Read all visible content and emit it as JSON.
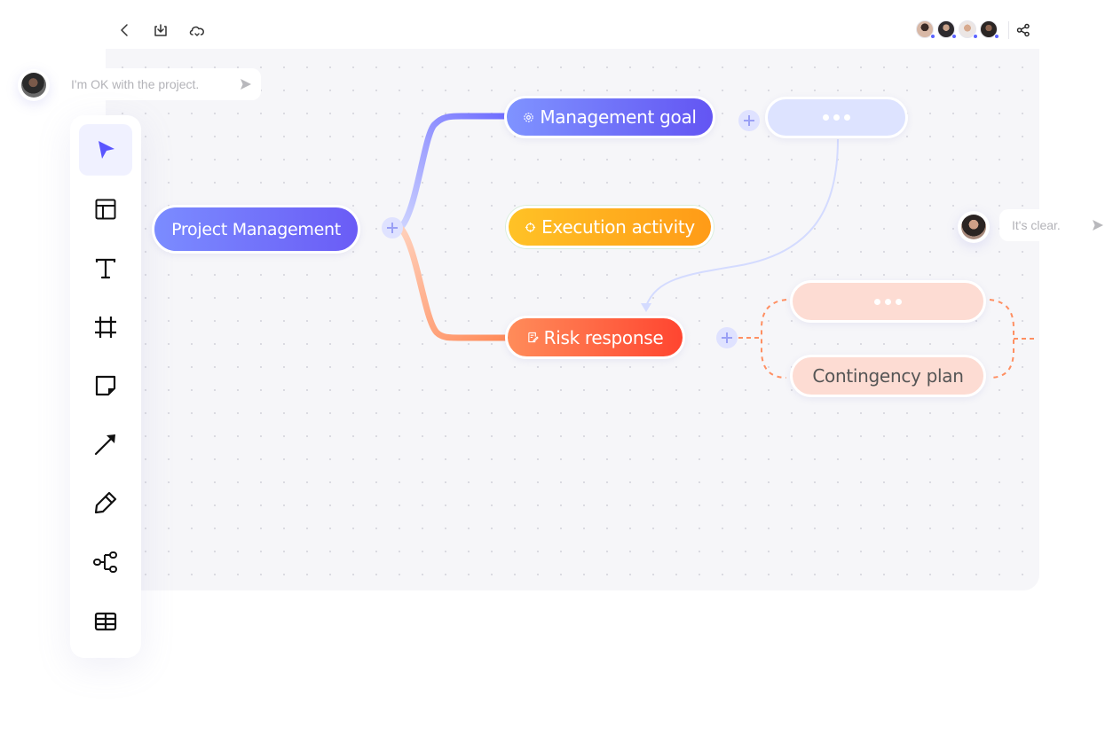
{
  "topbar": {
    "back_icon": "chevron-left-icon",
    "download_icon": "download-icon",
    "cloud_icon": "cloud-sync-icon",
    "collaborators": [
      {
        "name": "collaborator-1",
        "status": "online"
      },
      {
        "name": "collaborator-2",
        "status": "online"
      },
      {
        "name": "collaborator-3",
        "status": "online"
      },
      {
        "name": "collaborator-4",
        "status": "online"
      }
    ],
    "share_icon": "share-icon"
  },
  "comments": [
    {
      "text": "I'm OK with the project.",
      "send_icon": "send-icon"
    },
    {
      "text": "It's clear.",
      "send_icon": "send-icon"
    }
  ],
  "toolbar": {
    "tools": [
      {
        "name": "select",
        "icon": "cursor-icon",
        "active": true
      },
      {
        "name": "template",
        "icon": "layout-icon",
        "active": false
      },
      {
        "name": "text",
        "icon": "text-icon",
        "active": false
      },
      {
        "name": "frame",
        "icon": "frame-icon",
        "active": false
      },
      {
        "name": "sticky-note",
        "icon": "sticky-note-icon",
        "active": false
      },
      {
        "name": "connector",
        "icon": "arrow-icon",
        "active": false
      },
      {
        "name": "pen",
        "icon": "pencil-icon",
        "active": false
      },
      {
        "name": "mind-map",
        "icon": "mind-map-icon",
        "active": false
      },
      {
        "name": "table",
        "icon": "table-icon",
        "active": false
      }
    ]
  },
  "mindmap": {
    "root": {
      "label": "Project Management",
      "color": "#6f6cf8"
    },
    "branches": [
      {
        "label": "Management goal",
        "icon": "gear-icon",
        "color": "#6f77fb"
      },
      {
        "label": "Execution activity",
        "icon": "target-icon",
        "color": "#ffae1f"
      },
      {
        "label": "Risk response",
        "icon": "note-edit-icon",
        "color": "#ff6a45"
      }
    ],
    "sub_nodes": {
      "goal_placeholder": "...",
      "risk_placeholder": "...",
      "contingency": "Contingency plan"
    },
    "colors": {
      "blue_link": "#8a8dff",
      "yellow_link": "#ffc61f",
      "orange_link": "#ff8f62",
      "placeholder_blue": "#dde3ff",
      "placeholder_pink": "#fddcd3"
    }
  }
}
